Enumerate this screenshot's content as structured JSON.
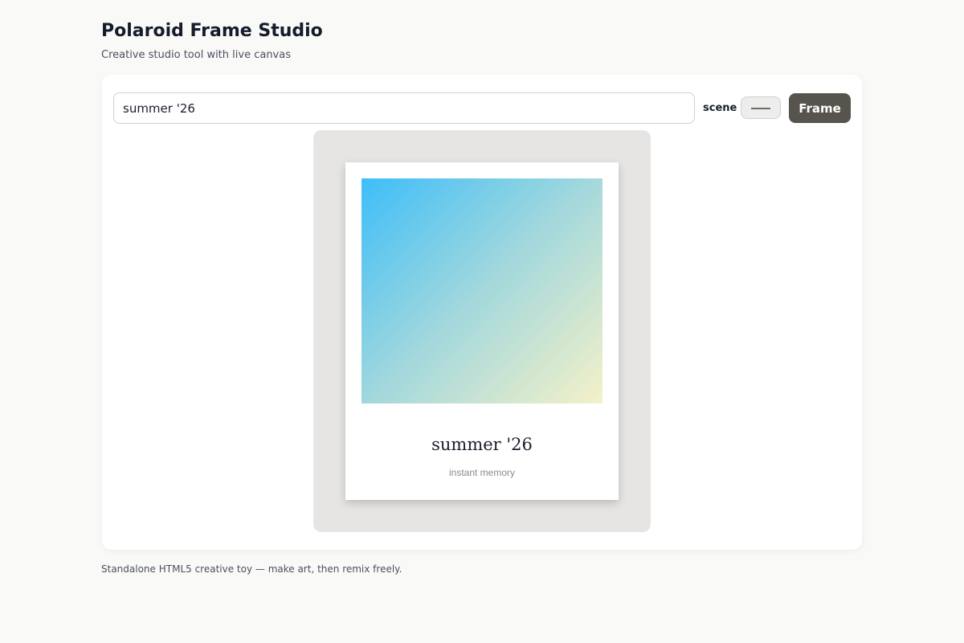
{
  "app": {
    "title": "Polaroid Frame Studio",
    "subtitle": "Creative studio tool with live canvas"
  },
  "toolbar": {
    "caption_value": "summer '26",
    "scene_label": "scene",
    "scene_icon": "dash-icon",
    "frame_button_label": "Frame"
  },
  "polaroid": {
    "caption": "summer '26",
    "subcaption": "instant memory",
    "gradient_colors": [
      "#3dbef9",
      "#a3d8dc",
      "#f4f1c8"
    ]
  },
  "footer": {
    "text": "Standalone HTML5 creative toy — make art, then remix freely."
  },
  "colors": {
    "accent": "#57534d",
    "stage": "#e6e5e3",
    "background": "#f9f9f7"
  }
}
